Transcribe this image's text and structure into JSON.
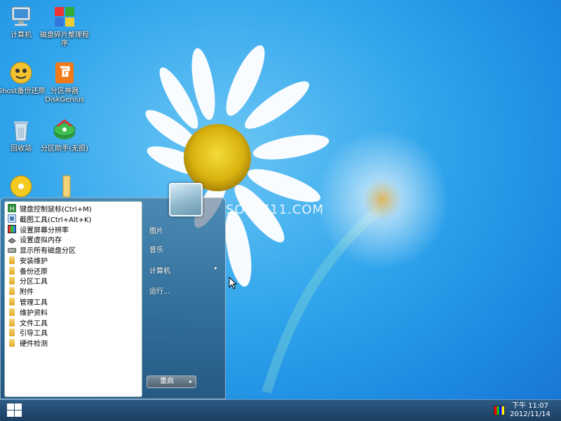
{
  "watermark": "SOFT711.COM",
  "desktop": {
    "icons": [
      {
        "label": "计算机",
        "icon": "computer-icon"
      },
      {
        "label": "磁盘碎片整理程序",
        "icon": "defrag-icon"
      },
      {
        "label": "Ghost备份还原",
        "icon": "ghost-icon"
      },
      {
        "label": "分区神器DiskGenius",
        "icon": "diskgenius-icon"
      },
      {
        "label": "回收站",
        "icon": "recycle-bin-icon"
      },
      {
        "label": "分区助手(无损)",
        "icon": "partition-assistant-icon"
      },
      {
        "label": "",
        "icon": "cd-drive-icon"
      },
      {
        "label": "",
        "icon": "folder-icon"
      }
    ]
  },
  "start_menu": {
    "programs": [
      {
        "label": "键盘控制鼠标(Ctrl+M)",
        "icon": "keyboard-mouse-icon"
      },
      {
        "label": "截图工具(Ctrl+Alt+K)",
        "icon": "screenshot-tool-icon"
      },
      {
        "label": "设置屏幕分辨率",
        "icon": "resolution-icon"
      },
      {
        "label": "设置虚拟内存",
        "icon": "virtual-memory-icon"
      },
      {
        "label": "显示所有磁盘分区",
        "icon": "disk-partition-icon"
      },
      {
        "label": "安装维护",
        "icon": "folder-icon"
      },
      {
        "label": "备份还原",
        "icon": "folder-icon"
      },
      {
        "label": "分区工具",
        "icon": "folder-icon"
      },
      {
        "label": "附件",
        "icon": "folder-icon"
      },
      {
        "label": "管理工具",
        "icon": "folder-icon"
      },
      {
        "label": "维护资料",
        "icon": "folder-icon"
      },
      {
        "label": "文件工具",
        "icon": "folder-icon"
      },
      {
        "label": "引导工具",
        "icon": "folder-icon"
      },
      {
        "label": "硬件检测",
        "icon": "folder-icon"
      }
    ],
    "right_items": [
      {
        "label": "图片"
      },
      {
        "label": "音乐"
      },
      {
        "label": "计算机",
        "arrow": "▸"
      },
      {
        "label": "运行..."
      }
    ],
    "restart_label": "重启",
    "restart_arrow": "▸"
  },
  "taskbar": {
    "clock_time": "下午 11:07",
    "clock_date": "2012/11/14"
  },
  "colors": {
    "wallpaper_sky": "#2fa4ec",
    "taskbar": "#1d3f63",
    "folder": "#e2a928"
  }
}
